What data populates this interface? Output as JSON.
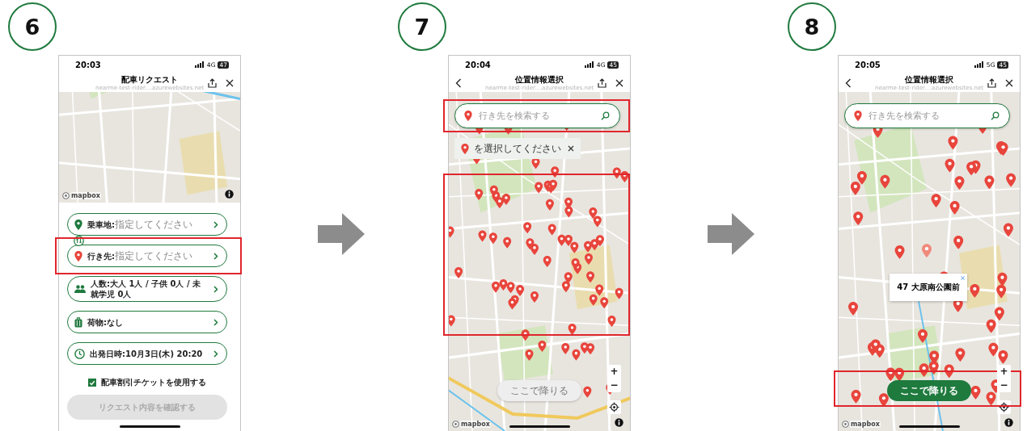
{
  "steps": [
    {
      "number": "6",
      "kind": "request",
      "status": {
        "time": "20:03",
        "network": "4G",
        "battery": "47"
      },
      "header": {
        "title": "配車リクエスト",
        "url": "nearme-test-rider....azurewebsites.net",
        "back": false
      },
      "logo": "mapbox",
      "rows": [
        {
          "kind": "pickup",
          "label": "乗車地:",
          "placeholder": "指定してください",
          "highlighted": false
        },
        {
          "kind": "destination",
          "label": "行き先:",
          "placeholder": "指定してください",
          "highlighted": true
        },
        {
          "kind": "people",
          "label": "人数:",
          "value": "大人 1人 / 子供 0人 / 未就学児 0人",
          "highlighted": false
        },
        {
          "kind": "luggage",
          "label": "荷物:",
          "value": "なし",
          "highlighted": false
        },
        {
          "kind": "time",
          "label": "出発日時:",
          "value": "10月3日(木) 20:20",
          "highlighted": false
        }
      ],
      "ticket": {
        "label": "配車割引チケットを使用する",
        "checked": true
      },
      "confirm": {
        "label": "リクエスト内容を確認する",
        "disabled": true
      }
    },
    {
      "number": "7",
      "kind": "map_select",
      "status": {
        "time": "20:04",
        "network": "4G",
        "battery": "45"
      },
      "header": {
        "title": "位置情報選択",
        "url": "nearme-test-rider....azurewebsites.net",
        "back": true
      },
      "logo": "mapbox",
      "search": {
        "placeholder": "行き先を検索する",
        "highlighted": true
      },
      "toast": {
        "text": "を選択してください"
      },
      "pins": {
        "kind": "cluster",
        "highlighted": true
      },
      "zoom_controls": [
        "+",
        "−"
      ],
      "drop_button": {
        "label": "ここで降りる",
        "disabled": true,
        "highlighted": false
      }
    },
    {
      "number": "8",
      "kind": "map_select",
      "status": {
        "time": "20:05",
        "network": "5G",
        "battery": "45"
      },
      "header": {
        "title": "位置情報選択",
        "url": "nearme-test-rider....azurewebsites.net",
        "back": true
      },
      "logo": "mapbox",
      "search": {
        "placeholder": "行き先を検索する",
        "highlighted": false
      },
      "popup": {
        "text": "47 大原南公園前"
      },
      "pins": {
        "kind": "scattered",
        "highlighted": false
      },
      "zoom_controls": [
        "+",
        "−"
      ],
      "drop_button": {
        "label": "ここで降りる",
        "disabled": false,
        "highlighted": true
      }
    }
  ]
}
